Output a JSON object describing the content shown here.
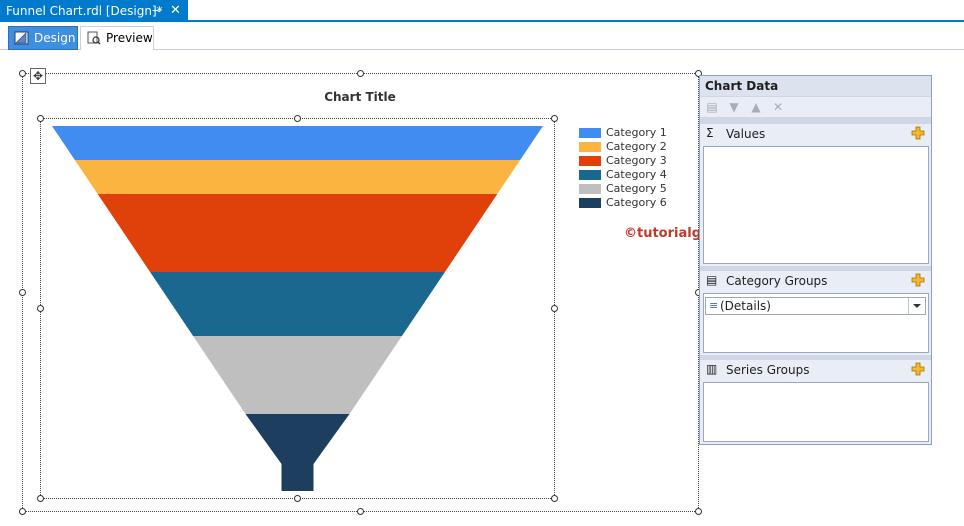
{
  "doc_tab": {
    "title": "Funnel Chart.rdl [Design]*",
    "pin_glyph": "⊸",
    "close_glyph": "✕"
  },
  "view_tabs": [
    {
      "label": "Design",
      "active": true,
      "icon": "design-ruler-icon"
    },
    {
      "label": "Preview",
      "active": false,
      "icon": "preview-icon"
    }
  ],
  "chart": {
    "title": "Chart Title",
    "watermark": "©tutorialgateway.org"
  },
  "chart_data": {
    "type": "funnel",
    "title": "Chart Title",
    "categories": [
      "Category 1",
      "Category 2",
      "Category 3",
      "Category 4",
      "Category 5",
      "Category 6"
    ],
    "colors": [
      "#418cf0",
      "#fcb441",
      "#e0400a",
      "#1a6790",
      "#bfbfbf",
      "#1d3e5f"
    ],
    "legend_position": "top-right"
  },
  "chart_data_pane": {
    "title": "Chart Data",
    "values_label": "Values",
    "category_groups_label": "Category Groups",
    "category_group_item": "(Details)",
    "series_groups_label": "Series Groups",
    "accent_plus_color": "#f0a30a"
  }
}
